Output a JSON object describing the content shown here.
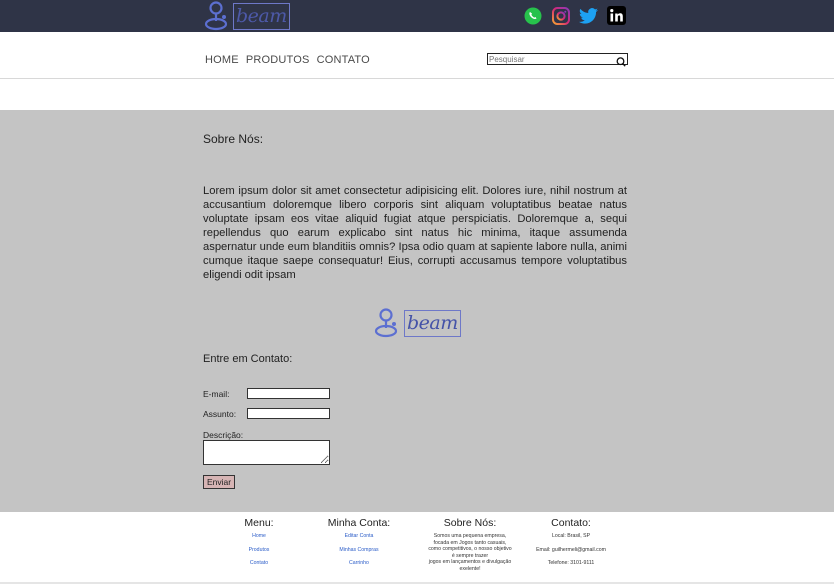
{
  "header": {
    "logo_text": "beam",
    "socials": [
      {
        "name": "whatsapp",
        "icon": "whatsapp-icon",
        "color": "#27c24c"
      },
      {
        "name": "instagram",
        "icon": "instagram-icon",
        "color": "#d62976"
      },
      {
        "name": "twitter",
        "icon": "twitter-icon",
        "color": "#1da1f2"
      },
      {
        "name": "linkedin",
        "icon": "linkedin-icon",
        "color": "#000000"
      }
    ]
  },
  "nav": {
    "items": [
      "HOME",
      "PRODUTOS",
      "CONTATO"
    ],
    "search_placeholder": "Pesquisar"
  },
  "about": {
    "title": "Sobre Nós:",
    "text": "Lorem ipsum dolor sit amet consectetur adipisicing elit. Dolores iure, nihil nostrum at accusantium doloremque libero corporis sint aliquam voluptatibus beatae natus voluptate ipsam eos vitae aliquid fugiat atque perspiciatis. Doloremque a, sequi repellendus quo earum explicabo sint natus hic minima, itaque assumenda aspernatur unde eum blanditiis omnis? Ipsa odio quam at sapiente labore nulla, animi cumque itaque saepe consequatur! Eius, corrupti accusamus tempore voluptatibus eligendi odit ipsam"
  },
  "contact_form": {
    "title": "Entre em Contato:",
    "email_label": "E-mail:",
    "subject_label": "Assunto:",
    "description_label": "Descrição:",
    "submit_label": "Enviar"
  },
  "footer": {
    "menu": {
      "title": "Menu:",
      "links": [
        "Home",
        "Produtos",
        "Contato"
      ]
    },
    "account": {
      "title": "Minha Conta:",
      "links": [
        "Editar Conta",
        "Minhas Compras",
        "Carrinho"
      ]
    },
    "about": {
      "title": "Sobre Nós:",
      "lines": [
        "Somos uma pequena empresa,",
        "focada em Jogos tanto casuais,",
        "como competitivos, o nosso objetivo",
        "é sempre trazer",
        "jogos em lançamentos e divulgação",
        "exelente!"
      ]
    },
    "contact": {
      "title": "Contato:",
      "lines": [
        "Local: Brasil, SP",
        "Email: guilhermeli@gmail.com",
        "Telefone: 3101-9111"
      ]
    }
  },
  "colors": {
    "topbar": "#2f3447",
    "main_bg": "#c4c4c4",
    "brand": "#4553a8",
    "button_bg": "#d6b4b4",
    "link": "#2a5cc8"
  }
}
